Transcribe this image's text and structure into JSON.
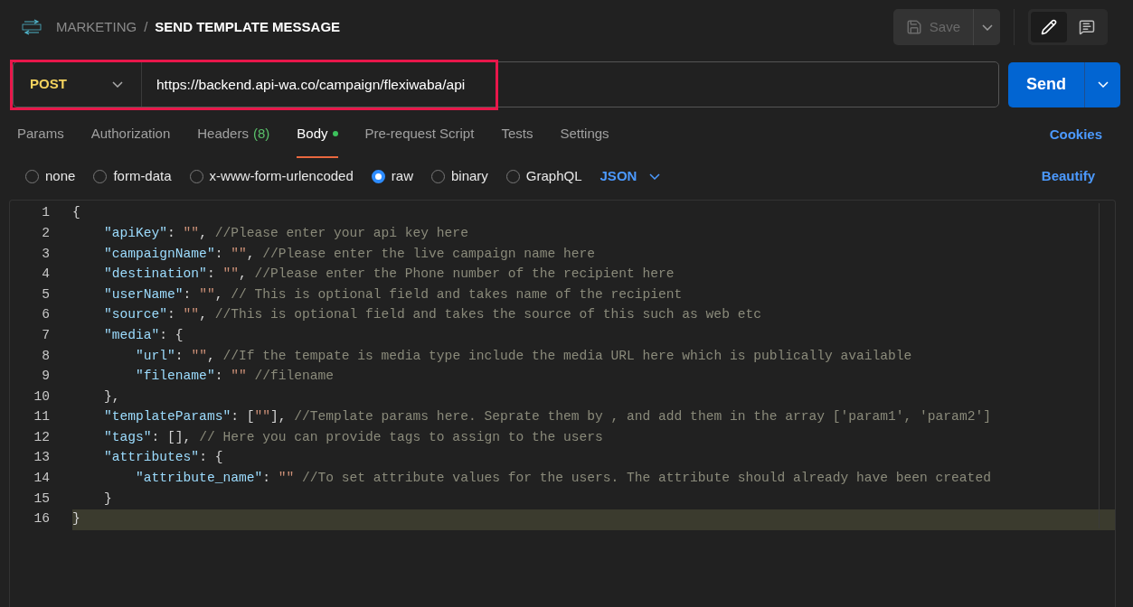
{
  "breadcrumb": {
    "parent": "MARKETING",
    "separator": "/",
    "title": "SEND TEMPLATE MESSAGE"
  },
  "toolbar": {
    "save_label": "Save",
    "save_disabled": true
  },
  "request": {
    "method": "POST",
    "url": "https://backend.api-wa.co/campaign/flexiwaba/api",
    "send_label": "Send",
    "highlighted": true
  },
  "tabs": [
    {
      "label": "Params",
      "selected": false
    },
    {
      "label": "Authorization",
      "selected": false
    },
    {
      "label": "Headers",
      "count": "(8)",
      "selected": false
    },
    {
      "label": "Body",
      "modified": true,
      "selected": true
    },
    {
      "label": "Pre-request Script",
      "selected": false
    },
    {
      "label": "Tests",
      "selected": false
    },
    {
      "label": "Settings",
      "selected": false
    }
  ],
  "cookies_link": "Cookies",
  "body_types": [
    {
      "label": "none",
      "selected": false
    },
    {
      "label": "form-data",
      "selected": false
    },
    {
      "label": "x-www-form-urlencoded",
      "selected": false
    },
    {
      "label": "raw",
      "selected": true
    },
    {
      "label": "binary",
      "selected": false
    },
    {
      "label": "GraphQL",
      "selected": false
    }
  ],
  "format": "JSON",
  "beautify_link": "Beautify",
  "editor": {
    "lines": [
      {
        "number": "1",
        "selected": false,
        "tokens": [
          {
            "kind": "punct",
            "text": "{"
          }
        ]
      },
      {
        "number": "2",
        "selected": false,
        "tokens": [
          {
            "kind": "key",
            "text": "    \"apiKey\""
          },
          {
            "kind": "punct",
            "text": ": "
          },
          {
            "kind": "string",
            "text": "\"\""
          },
          {
            "kind": "punct",
            "text": ", "
          },
          {
            "kind": "comment",
            "text": "//Please enter your api key here"
          }
        ]
      },
      {
        "number": "3",
        "selected": false,
        "tokens": [
          {
            "kind": "key",
            "text": "    \"campaignName\""
          },
          {
            "kind": "punct",
            "text": ": "
          },
          {
            "kind": "string",
            "text": "\"\""
          },
          {
            "kind": "punct",
            "text": ", "
          },
          {
            "kind": "comment",
            "text": "//Please enter the live campaign name here"
          }
        ]
      },
      {
        "number": "4",
        "selected": false,
        "tokens": [
          {
            "kind": "key",
            "text": "    \"destination\""
          },
          {
            "kind": "punct",
            "text": ": "
          },
          {
            "kind": "string",
            "text": "\"\""
          },
          {
            "kind": "punct",
            "text": ", "
          },
          {
            "kind": "comment",
            "text": "//Please enter the Phone number of the recipient here"
          }
        ]
      },
      {
        "number": "5",
        "selected": false,
        "tokens": [
          {
            "kind": "key",
            "text": "    \"userName\""
          },
          {
            "kind": "punct",
            "text": ": "
          },
          {
            "kind": "string",
            "text": "\"\""
          },
          {
            "kind": "punct",
            "text": ", "
          },
          {
            "kind": "comment",
            "text": "// This is optional field and takes name of the recipient"
          }
        ]
      },
      {
        "number": "6",
        "selected": false,
        "tokens": [
          {
            "kind": "key",
            "text": "    \"source\""
          },
          {
            "kind": "punct",
            "text": ": "
          },
          {
            "kind": "string",
            "text": "\"\""
          },
          {
            "kind": "punct",
            "text": ", "
          },
          {
            "kind": "comment",
            "text": "//This is optional field and takes the source of this such as web etc"
          }
        ]
      },
      {
        "number": "7",
        "selected": false,
        "tokens": [
          {
            "kind": "key",
            "text": "    \"media\""
          },
          {
            "kind": "punct",
            "text": ": {"
          }
        ]
      },
      {
        "number": "8",
        "selected": false,
        "tokens": [
          {
            "kind": "key",
            "text": "        \"url\""
          },
          {
            "kind": "punct",
            "text": ": "
          },
          {
            "kind": "string",
            "text": "\"\""
          },
          {
            "kind": "punct",
            "text": ", "
          },
          {
            "kind": "comment",
            "text": "//If the tempate is media type include the media URL here which is publically available"
          }
        ]
      },
      {
        "number": "9",
        "selected": false,
        "tokens": [
          {
            "kind": "key",
            "text": "        \"filename\""
          },
          {
            "kind": "punct",
            "text": ": "
          },
          {
            "kind": "string",
            "text": "\"\""
          },
          {
            "kind": "comment",
            "text": " //filename"
          }
        ]
      },
      {
        "number": "10",
        "selected": false,
        "tokens": [
          {
            "kind": "punct",
            "text": "    },"
          }
        ]
      },
      {
        "number": "11",
        "selected": false,
        "tokens": [
          {
            "kind": "key",
            "text": "    \"templateParams\""
          },
          {
            "kind": "punct",
            "text": ": ["
          },
          {
            "kind": "string",
            "text": "\"\""
          },
          {
            "kind": "punct",
            "text": "], "
          },
          {
            "kind": "comment",
            "text": "//Template params here. Seprate them by , and add them in the array ['param1', 'param2']"
          }
        ]
      },
      {
        "number": "12",
        "selected": false,
        "tokens": [
          {
            "kind": "key",
            "text": "    \"tags\""
          },
          {
            "kind": "punct",
            "text": ": [], "
          },
          {
            "kind": "comment",
            "text": "// Here you can provide tags to assign to the users"
          }
        ]
      },
      {
        "number": "13",
        "selected": false,
        "tokens": [
          {
            "kind": "key",
            "text": "    \"attributes\""
          },
          {
            "kind": "punct",
            "text": ": {"
          }
        ]
      },
      {
        "number": "14",
        "selected": false,
        "tokens": [
          {
            "kind": "key",
            "text": "        \"attribute_name\""
          },
          {
            "kind": "punct",
            "text": ": "
          },
          {
            "kind": "string",
            "text": "\"\""
          },
          {
            "kind": "comment",
            "text": " //To set attribute values for the users. The attribute should already have been created"
          }
        ]
      },
      {
        "number": "15",
        "selected": false,
        "tokens": [
          {
            "kind": "punct",
            "text": "    }"
          }
        ]
      },
      {
        "number": "16",
        "selected": true,
        "tokens": [
          {
            "kind": "punct",
            "text": "}"
          }
        ]
      }
    ]
  }
}
